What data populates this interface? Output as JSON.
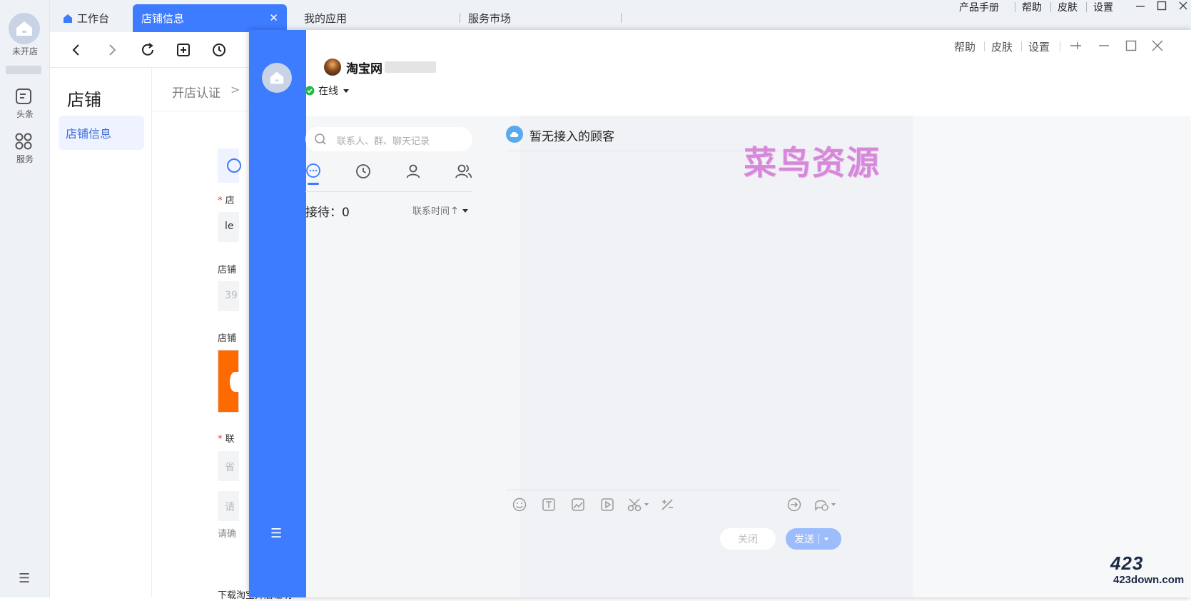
{
  "rail": {
    "shop_status": "未开店",
    "items": [
      {
        "label": "头条",
        "icon": "news-icon"
      },
      {
        "label": "服务",
        "icon": "apps-icon"
      }
    ],
    "menu_icon": "☰"
  },
  "tabs": [
    {
      "label": "工作台",
      "active": false
    },
    {
      "label": "店铺信息",
      "active": true
    },
    {
      "label": "我的应用",
      "active": false
    },
    {
      "label": "服务市场",
      "active": false
    }
  ],
  "tab_close": "✕",
  "top_menu": {
    "manual": "产品手册",
    "help": "帮助",
    "skin": "皮肤",
    "settings": "设置"
  },
  "toolbar": {
    "back": "‹",
    "forward": "›"
  },
  "shop": {
    "title": "店铺",
    "side_item": "店铺信息",
    "breadcrumb": "开店认证",
    "breadcrumb_sep": ">",
    "required_mark": "*",
    "field1_label": "店",
    "field1_value": "le",
    "field2_label": "店铺",
    "field2_value": "39",
    "field3_label": "店铺",
    "field4_label": "联",
    "field4_placeholder": "省",
    "field5_placeholder": "请",
    "hint": "请确",
    "bottom_text": "下载淘宝开店证明"
  },
  "chat": {
    "header": {
      "help": "帮助",
      "skin": "皮肤",
      "settings": "设置"
    },
    "account_name": "淘宝网",
    "status": "在线",
    "search_placeholder": "联系人、群、聊天记录",
    "reception_label": "接待：0",
    "sort_label": "联系时间",
    "no_customer": "暂无接入的顾客",
    "close_button": "关闭",
    "send_button": "发送",
    "menu_icon": "☰"
  },
  "watermark": {
    "text": "菜鸟资源",
    "site_top": "423",
    "site_bottom": "423down.com"
  },
  "colors": {
    "accent": "#3d7bff",
    "online": "#27b84a",
    "watermark": "#d48ad8"
  }
}
